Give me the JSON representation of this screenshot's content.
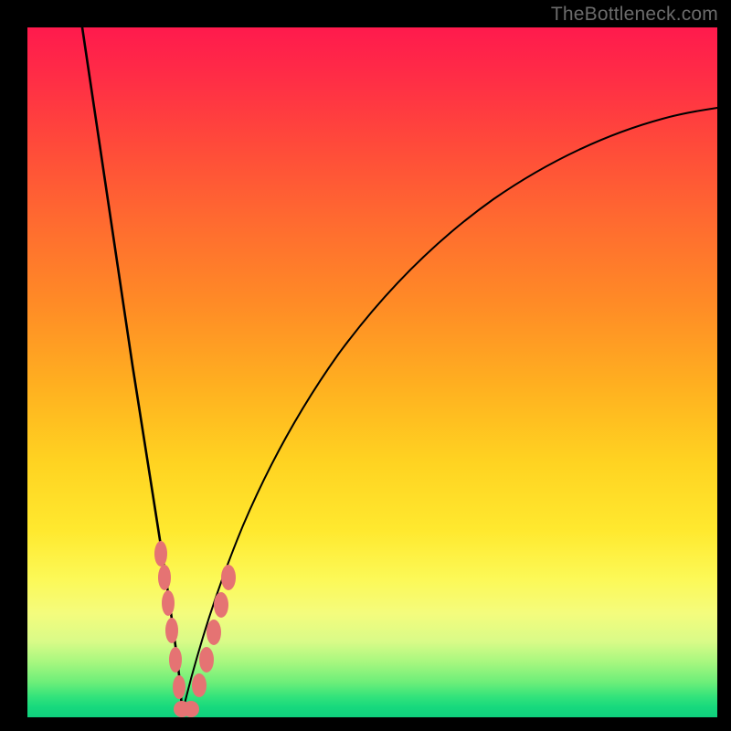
{
  "watermark": "TheBottleneck.com",
  "colors": {
    "frame": "#000000",
    "gradient_top": "#ff1a4d",
    "gradient_mid": "#ffd321",
    "gradient_bottom": "#0fd07d",
    "curve": "#000000",
    "marker": "#e57373"
  },
  "chart_data": {
    "type": "line",
    "title": "",
    "xlabel": "",
    "ylabel": "",
    "xlim": [
      0,
      100
    ],
    "ylim": [
      0,
      100
    ],
    "x": [
      0,
      2,
      5,
      8,
      10,
      12,
      14,
      16,
      18,
      19,
      20,
      21,
      22,
      23,
      24,
      26,
      28,
      30,
      33,
      36,
      40,
      45,
      50,
      55,
      60,
      66,
      72,
      80,
      88,
      94,
      100
    ],
    "y": [
      100,
      92,
      81,
      70,
      62,
      54,
      45,
      36,
      25,
      18,
      10,
      3,
      0,
      2,
      6,
      13,
      20,
      27,
      35,
      42,
      50,
      58,
      64,
      69,
      73,
      77,
      80,
      83,
      85.5,
      87,
      88
    ],
    "markers": {
      "x": [
        17.0,
        17.7,
        18.3,
        19.0,
        19.8,
        20.7,
        21.5,
        22.3,
        23.5,
        24.3,
        25.3,
        26.0,
        26.8
      ],
      "y": [
        31,
        26,
        22,
        17,
        11,
        5,
        2,
        1,
        5,
        9,
        14,
        18,
        22
      ]
    },
    "annotations": []
  }
}
